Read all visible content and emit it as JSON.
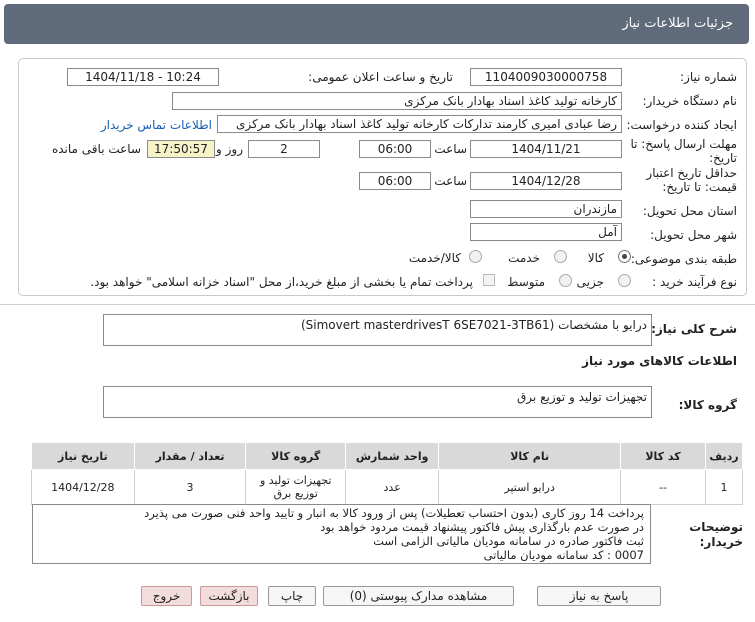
{
  "header": {
    "title": "جزئیات اطلاعات نیاز"
  },
  "form": {
    "need_number_label": "شماره نیاز:",
    "need_number": "1104009030000758",
    "announce_label": "تاریخ و ساعت اعلان عمومی:",
    "announce_value": "1404/11/18 - 10:24",
    "buyer_org_label": "نام دستگاه خریدار:",
    "buyer_org": "کارخانه تولید کاغذ اسناد بهادار بانک مرکزی",
    "creator_label": "ایجاد کننده درخواست:",
    "creator": "رضا عبادی امیری کارمند تدارکات کارخانه تولید کاغذ اسناد بهادار بانک مرکزی",
    "contact_link": "اطلاعات تماس خریدار",
    "deadline_label": "مهلت ارسال پاسخ: تا تاریخ:",
    "deadline_date": "1404/11/21",
    "time_label": "ساعت",
    "deadline_time": "06:00",
    "days_value": "2",
    "days_label": "روز و",
    "remaining_time": "17:50:57",
    "remaining_label": "ساعت باقی مانده",
    "validity_label": "حداقل تاریخ اعتبار قیمت: تا تاریخ:",
    "validity_date": "1404/12/28",
    "validity_time": "06:00",
    "province_label": "استان محل تحویل:",
    "province": "مازندران",
    "city_label": "شهر محل تحویل:",
    "city": "آمل",
    "category_label": "طبقه بندی موضوعی:",
    "category_options": [
      "کالا",
      "خدمت",
      "کالا/خدمت"
    ],
    "process_label": "نوع فرآیند خرید :",
    "process_options": [
      "جزیی",
      "متوسط"
    ],
    "payment_note": "پرداخت تمام یا بخشی از مبلغ خرید،از محل \"اسناد خزانه اسلامی\" خواهد بود."
  },
  "general": {
    "desc_label": "شرح کلی نیاز:",
    "desc": "درایو با مشخصات (Simovert masterdrivesT 6SE7021-3TB61)",
    "goods_info_title": "اطلاعات کالاهای مورد نیاز",
    "group_label": "گروه کالا:",
    "group": "تجهیزات تولید و توزیع برق"
  },
  "table": {
    "headers": [
      "ردیف",
      "کد کالا",
      "نام کالا",
      "واحد شمارش",
      "گروه کالا",
      "تعداد / مقدار",
      "تاریخ نیاز"
    ],
    "rows": [
      [
        "1",
        "--",
        "درایو استپر",
        "عدد",
        "تجهیزات تولید و توزیع برق",
        "3",
        "1404/12/28"
      ]
    ]
  },
  "notes": {
    "label": "توضیحات خریدار:",
    "lines": [
      "پرداخت 14 روز کاری (بدون احتساب تعطیلات) پس از ورود کالا به انبار و تایید واحد فنی صورت می پذیرد",
      "در صورت عدم بارگذاری پیش فاکتور پیشنهاد قیمت مردود خواهد بود",
      "ثبت فاکتور صادره در سامانه مودیان مالیاتی الزامی است",
      "0007 : کد سامانه مودیان مالیاتی"
    ]
  },
  "buttons": {
    "reply": "پاسخ به نیاز",
    "attachments": "مشاهده مدارک پیوستی (0)",
    "print": "چاپ",
    "back": "بازگشت",
    "exit": "خروج"
  }
}
